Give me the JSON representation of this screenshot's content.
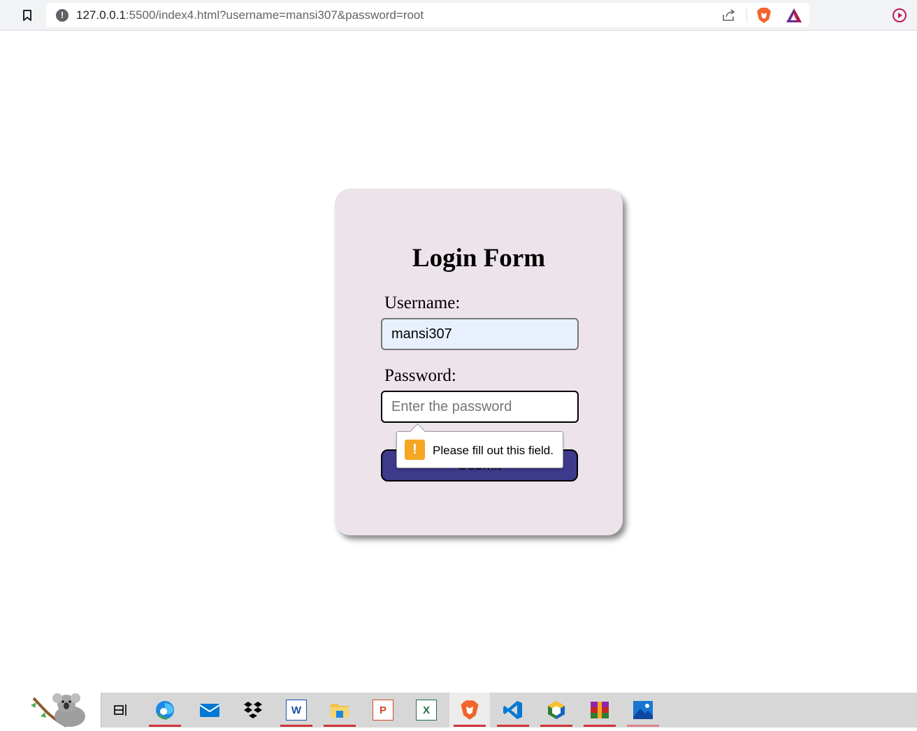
{
  "browser": {
    "url_host": "127.0.0.1",
    "url_rest": ":5500/index4.html?username=mansi307&password=root",
    "icons": [
      "bookmark-icon",
      "site-info-icon",
      "share-icon",
      "brave-shield-icon",
      "brave-rewards-icon",
      "media-play-icon"
    ]
  },
  "form": {
    "title": "Login Form",
    "username_label": "Username:",
    "username_value": "mansi307",
    "password_label": "Password:",
    "password_placeholder": "Enter the password",
    "submit_label": "Submit"
  },
  "validation": {
    "message": "Please fill out this field.",
    "icon": "warning-icon",
    "icon_glyph": "!"
  },
  "taskbar": {
    "items": [
      {
        "name": "task-view",
        "icon": "task-view-icon"
      },
      {
        "name": "edge",
        "icon": "edge-icon"
      },
      {
        "name": "mail",
        "icon": "mail-icon"
      },
      {
        "name": "dropbox",
        "icon": "dropbox-icon"
      },
      {
        "name": "word",
        "icon": "word-icon",
        "glyph": "W"
      },
      {
        "name": "file-explorer",
        "icon": "folder-icon"
      },
      {
        "name": "powerpoint",
        "icon": "powerpoint-icon",
        "glyph": "P"
      },
      {
        "name": "excel",
        "icon": "excel-icon",
        "glyph": "X"
      },
      {
        "name": "brave",
        "icon": "brave-icon"
      },
      {
        "name": "vscode",
        "icon": "vscode-icon"
      },
      {
        "name": "app-hexagon",
        "icon": "hexagon-icon"
      },
      {
        "name": "winrar",
        "icon": "winrar-icon"
      },
      {
        "name": "photos",
        "icon": "photos-icon"
      }
    ]
  },
  "colors": {
    "card_bg": "#ece4ea",
    "submit_bg": "#3d3a8c",
    "username_bg": "#e8f0fe",
    "warning": "#f5a623",
    "taskbar_indicator": "#d13438"
  }
}
